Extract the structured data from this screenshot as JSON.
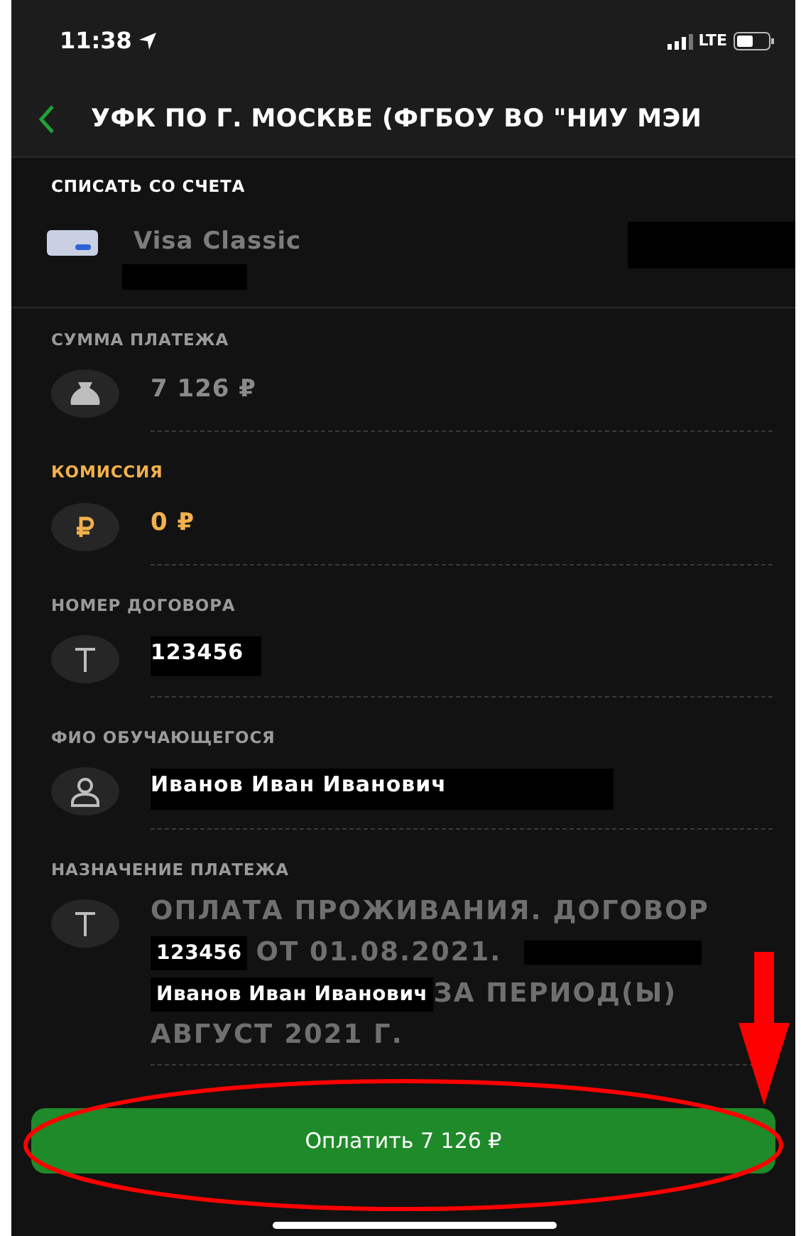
{
  "status_bar": {
    "time": "11:38",
    "network": "LTE"
  },
  "header": {
    "title": "УФК ПО Г. МОСКВЕ (ФГБОУ ВО \"НИУ МЭИ"
  },
  "account": {
    "label": "СПИСАТЬ СО СЧЕТА",
    "card_name": "Visa Classic",
    "redacted": true
  },
  "fields": [
    {
      "kind": "amount",
      "label": "СУММА ПЛАТЕЖА",
      "value": "7 126 ₽",
      "highlight": false,
      "redacted": false
    },
    {
      "kind": "fee",
      "label": "КОМИССИЯ",
      "value": "0 ₽",
      "highlight": true,
      "redacted": false
    },
    {
      "kind": "text",
      "label": "НОМЕР ДОГОВОРА",
      "value": "123456",
      "highlight": false,
      "redacted": true
    },
    {
      "kind": "person",
      "label": "ФИО ОБУЧАЮЩЕГОСЯ",
      "value": "Иванов Иван Иванович",
      "highlight": false,
      "redacted": true
    }
  ],
  "purpose": {
    "label": "НАЗНАЧЕНИЕ ПЛАТЕЖА",
    "lines": [
      [
        {
          "kind": "plain",
          "text": "ОПЛАТА ПРОЖИВАНИЯ. ДОГОВОР"
        }
      ],
      [
        {
          "kind": "inserted",
          "text": "123456"
        },
        {
          "kind": "plain",
          "text": "ОТ 01.08.2021."
        },
        {
          "kind": "redaction"
        }
      ],
      [
        {
          "kind": "inserted",
          "text": "Иванов Иван Иванович"
        },
        {
          "kind": "plain",
          "text": "ЗА ПЕРИОД(Ы)"
        }
      ],
      [
        {
          "kind": "plain",
          "text": "АВГУСТ 2021 Г."
        }
      ]
    ]
  },
  "pay_button": {
    "label": "Оплатить 7 126 ₽"
  },
  "annotation": {
    "kind": "circle-and-arrow",
    "color": "#ff0000"
  }
}
